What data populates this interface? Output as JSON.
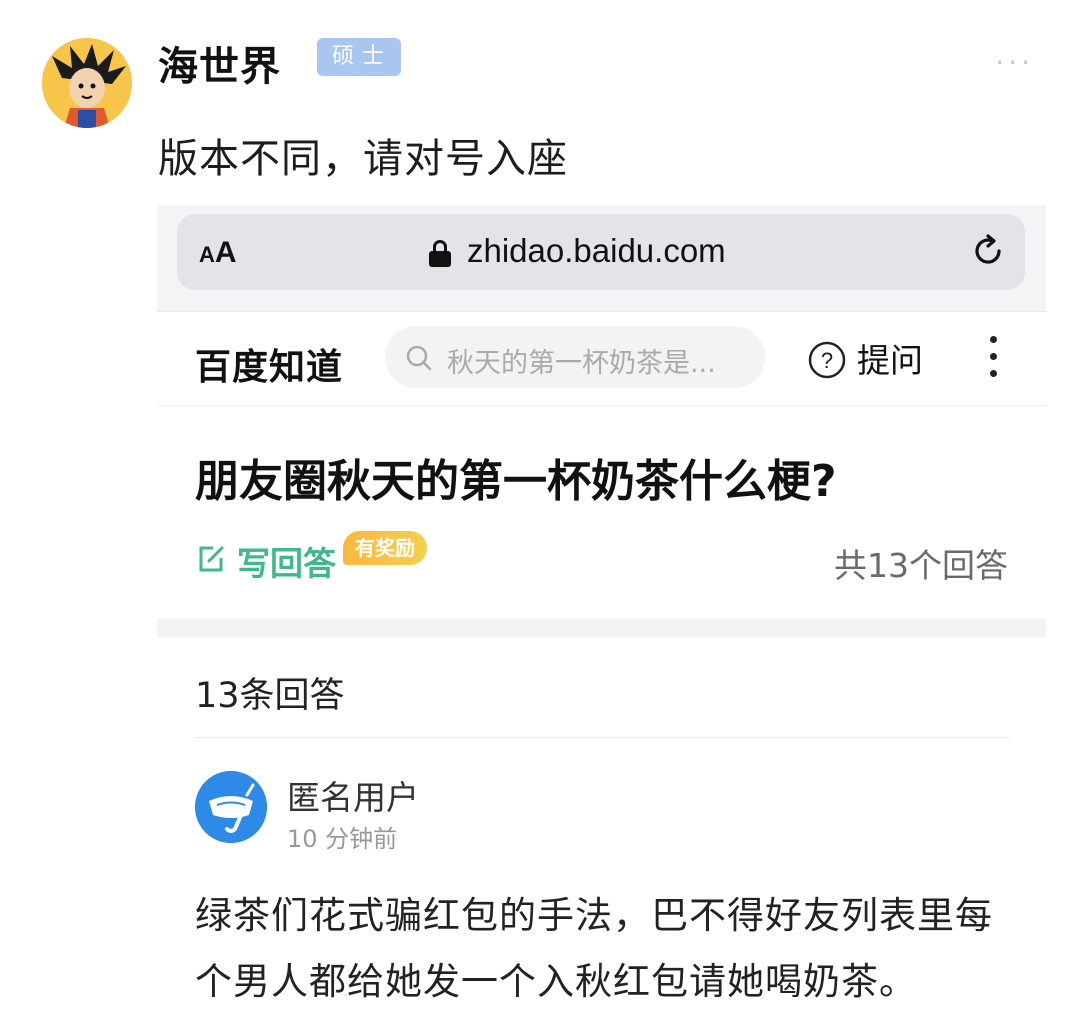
{
  "post": {
    "username": "海世界",
    "badge": "硕士",
    "more": "···",
    "text": "版本不同，请对号入座"
  },
  "browser": {
    "aa_label_small": "A",
    "aa_label_big": "A",
    "url": "zhidao.baidu.com"
  },
  "site": {
    "logo": "百度知道",
    "search_placeholder": "秋天的第一杯奶茶是...",
    "ask_label": "提问"
  },
  "question": {
    "title": "朋友圈秋天的第一杯奶茶什么梗?",
    "write_label": "写回答",
    "reward_badge": "有奖励",
    "total_answers": "共13个回答"
  },
  "answers": {
    "count_label": "13条回答",
    "items": [
      {
        "user": "匿名用户",
        "time": "10 分钟前",
        "lines": [
          "绿茶们花式骗红包的手法，巴不得好友列表里每",
          "个男人都给她发一个入秋红包请她喝奶茶。"
        ]
      }
    ]
  },
  "colors": {
    "accent_green": "#3fb88b",
    "badge_blue": "#a9c6f0",
    "reward_orange": "#f9b73d",
    "anon_avatar_blue": "#2d8ae6"
  },
  "icons": [
    "more-dots-icon",
    "lock-icon",
    "reload-icon",
    "search-icon",
    "question-circle-icon",
    "kebab-menu-icon",
    "edit-icon"
  ]
}
